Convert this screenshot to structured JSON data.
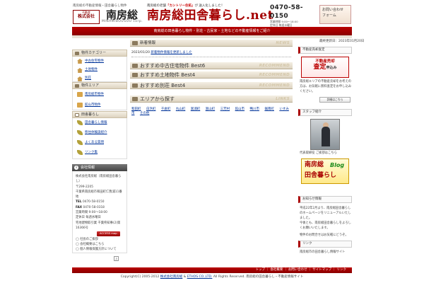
{
  "header": {
    "tagline": "南房総の不動産情報・田舎暮らし物件",
    "logo_seal_top": "不動産",
    "logo_seal_mid": "株式会社",
    "logo_corp": "株式\n会社",
    "logo_main": "南房総",
    "logo_roman": "MINAMIBOUSOU corp.",
    "catch_prefix": "南房総の老舗",
    "catch_highlight": "「カントリー住拓」",
    "catch_suffix": "が 送入化しました！",
    "site_title": "南房総田舎暮らし.net",
    "phone": "0470-58-0150",
    "hours_1": "営業時間 9:00〜18:00",
    "hours_2": "定休日 毎週水曜日",
    "contact_label_1": "お問い合わせ",
    "contact_label_2": "フォーム"
  },
  "nav": {
    "band_text": "南房総の田舎暮らし物件・別荘・古民家・土地などの不動産情報をご紹介"
  },
  "left": {
    "box1_title": "物件カテゴリー",
    "box1_items": [
      "中古住宅物件",
      "土地物件",
      "別荘"
    ],
    "box2_title": "物件エリア",
    "box2_items": [
      "南房総市物件",
      "館山市物件"
    ],
    "box3_title": "田舎暮らし",
    "box3_items": [
      "田舎暮らし情報",
      "移住体験談紹介",
      "よくある質問",
      "リンク集"
    ],
    "info_title": "会社情報",
    "info_company": "株式会社南房総（南房総田舎暮らし）",
    "info_zip": "〒299-2205",
    "info_addr": "千葉県南房総市和田町仁我浦11番地",
    "tel_label": "TEL",
    "tel": "0470-58-0150",
    "fax_label": "FAX",
    "fax": "0470-58-0318",
    "open": "営業時間 9:00〜18:00",
    "closed": "定休日 毎週水曜日",
    "license": "宅地建物取引業 千葉県知事(2)第16366号",
    "access_btn": "ACCESS map",
    "links": [
      "社長のご挨拶",
      "会社概要はこちら",
      "個人情報保護方針について"
    ],
    "top_mark": "上"
  },
  "center": {
    "news_title": "新着情報",
    "news_label": "NEWS",
    "news_date": "2023/01/20",
    "news_link": "新着物件情報を更新しました",
    "rec1_title": "おすすめ中古住宅物件 Best6",
    "rec2_title": "おすすめ土地物件 Best4",
    "rec3_title": "おすすめ別荘 Best4",
    "rec_label": "RECOMMEND",
    "links_title": "エリアから探す",
    "links_label": "LINKS",
    "tags": [
      "和田町",
      "白浜町",
      "千倉町",
      "丸山町",
      "富浦町",
      "富山町",
      "三芳村",
      "館山市",
      "鴨川市",
      "鋸南町",
      "いすみ市",
      "その他"
    ]
  },
  "right": {
    "date": "最終更新日：2023年01月20日",
    "satei_head": "不動産売却査定",
    "satei_line1": "不動産売却",
    "satei_line2": "査定",
    "satei_line2_small": "申込み",
    "satei_text": "南房総エリアの不動産売却をお考えの方は、お気軽に無料査定をお申し込みください。",
    "detail_btn": "詳細はこちら",
    "staff_head": "スタッフ紹介",
    "staff_caption": "代表取締役 ご挨拶はこちら",
    "blog_line1": "南房総",
    "blog_line2": "Blog",
    "blog_line3": "田舎暮らし",
    "info_head": "お知らせ情報",
    "info_text_1": "平成22年2月より、南房総田舎暮らしのホームページをリニューアルいたしました。",
    "info_text_2": "今後とも、南房総田舎暮らしをよろしくお願いいたします。",
    "info_text_3": "物件のお問合せはお気軽にどうぞ。",
    "link_head": "リンク",
    "link_text": "南房総市の田舎暮らし情報サイト"
  },
  "footer": {
    "band_links": "トップ ｜ 会社概要 ｜ お問い合わせ ｜ サイトマップ ｜ リンク",
    "copyright_prefix": "Copyright(C) 2005-2012",
    "copyright_company": "株式会社南房総",
    "copyright_amp": "&",
    "copyright_ethos": "ETHOS CO.,LTD.",
    "copyright_suffix": "All Rights Reserved.",
    "copyright_note": "南房総の田舎暮らし・不動産情報サイト"
  },
  "colors": {
    "brand_red": "#a50000",
    "link_blue": "#003399"
  }
}
